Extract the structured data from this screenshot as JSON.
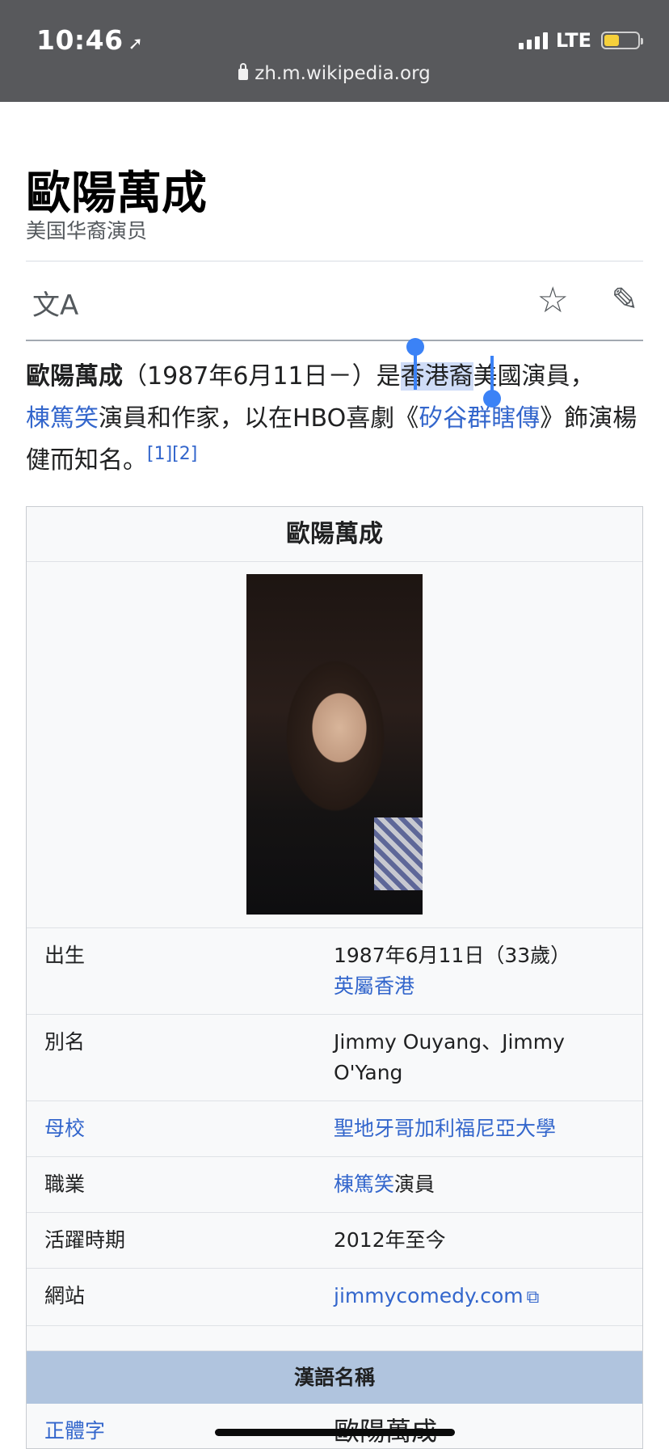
{
  "status_bar": {
    "time": "10:46",
    "carrier": "LTE",
    "battery_level": 0.45
  },
  "url_bar": {
    "domain": "zh.m.wikipedia.org"
  },
  "page": {
    "title": "歐陽萬成",
    "subtitle": "美国华裔演员"
  },
  "actions": {
    "language_icon": "文A",
    "star_icon": "☆",
    "edit_icon": "✎"
  },
  "lead": {
    "name": "歐陽萬成",
    "dates": "（1987年6月11日－）",
    "is": "是",
    "selected": "香港裔",
    "after_sel": "美國演員，",
    "link_standup": "棟篤笑",
    "mid": "演員和作家，以在HBO喜劇《",
    "link_show": "矽谷群瞎傳",
    "end": "》飾演楊健而知名。",
    "refs": "[1][2]"
  },
  "infobox": {
    "title": "歐陽萬成",
    "rows": [
      {
        "label": "出生",
        "value": "1987年6月11日（33歲）",
        "value_link": "英屬香港"
      },
      {
        "label": "別名",
        "value": "Jimmy Ouyang、Jimmy O'Yang"
      },
      {
        "label_link": "母校",
        "value_link": "聖地牙哥加利福尼亞大學"
      },
      {
        "label": "職業",
        "value_link": "棟篤笑",
        "value": "演員"
      },
      {
        "label": "活躍時期",
        "value": "2012年至今"
      },
      {
        "label": "網站",
        "value_link": "jimmycomedy.com"
      }
    ],
    "section_header": "漢語名稱",
    "name_row": {
      "label_link": "正體字",
      "value": "歐陽萬成"
    }
  }
}
